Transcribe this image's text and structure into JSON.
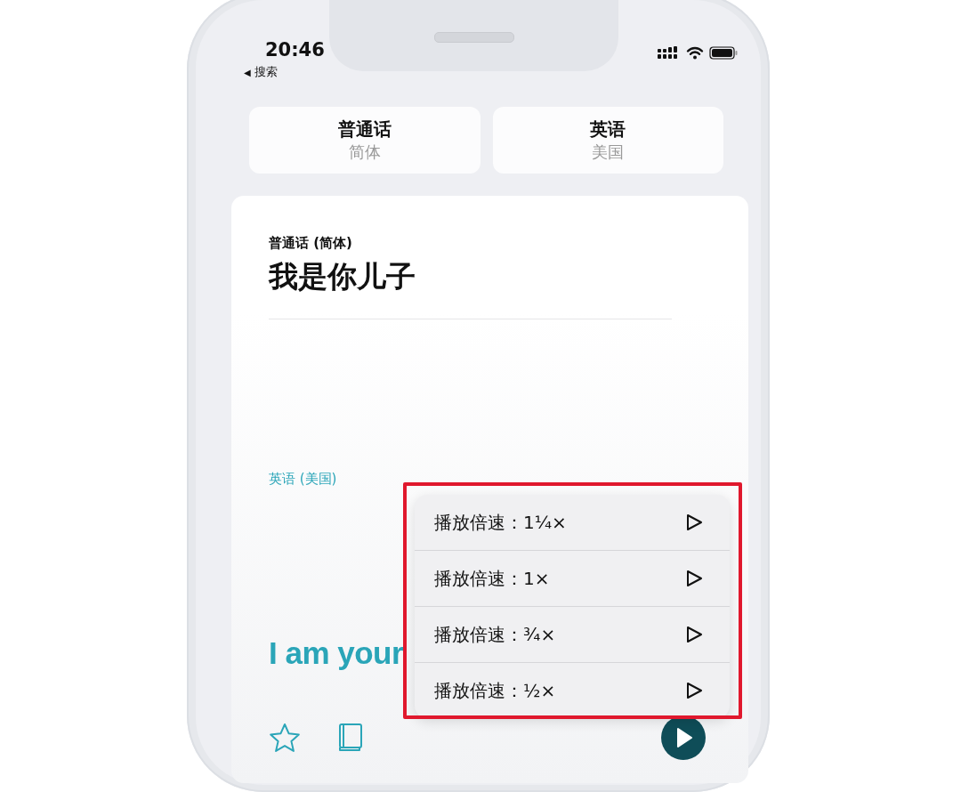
{
  "status_bar": {
    "time": "20:46",
    "back_arrow": "◀",
    "back_label": "搜索"
  },
  "languages": [
    {
      "name": "普通话",
      "variant": "简体"
    },
    {
      "name": "英语",
      "variant": "美国"
    }
  ],
  "source": {
    "label": "普通话 (简体)",
    "text": "我是你儿子"
  },
  "target": {
    "label": "英语 (美国)",
    "text": "I am your"
  },
  "speed_menu": {
    "items": [
      {
        "label": "播放倍速：1¼×"
      },
      {
        "label": "播放倍速：1×"
      },
      {
        "label": "播放倍速：¾×"
      },
      {
        "label": "播放倍速：½×"
      }
    ]
  },
  "highlight": {
    "kind": "frame"
  }
}
